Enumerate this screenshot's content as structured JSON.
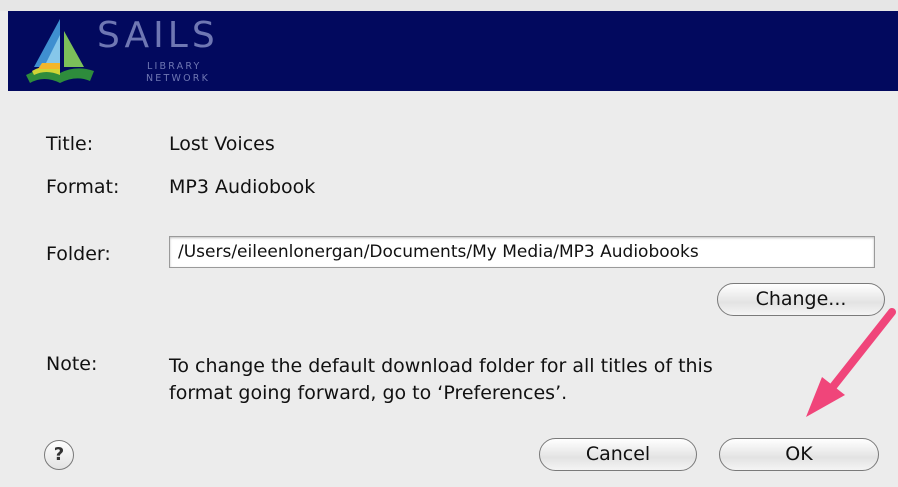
{
  "header": {
    "logo": {
      "name": "SAILS",
      "line1": "LIBRARY",
      "line2": "NETWORK"
    },
    "background_color": "#02095e"
  },
  "fields": {
    "title_label": "Title:",
    "title_value": "Lost Voices",
    "format_label": "Format:",
    "format_value": "MP3 Audiobook",
    "folder_label": "Folder:",
    "folder_value": "/Users/eileenlonergan/Documents/My Media/MP3 Audiobooks"
  },
  "buttons": {
    "change": "Change...",
    "cancel": "Cancel",
    "ok": "OK",
    "help": "?"
  },
  "note": {
    "label": "Note:",
    "line1": "To change the default download folder for all titles of this",
    "line2": "format going forward, go to ‘Preferences’."
  },
  "annotation": {
    "arrow_color": "#f0457a",
    "icon": "arrow-pointer-icon"
  }
}
